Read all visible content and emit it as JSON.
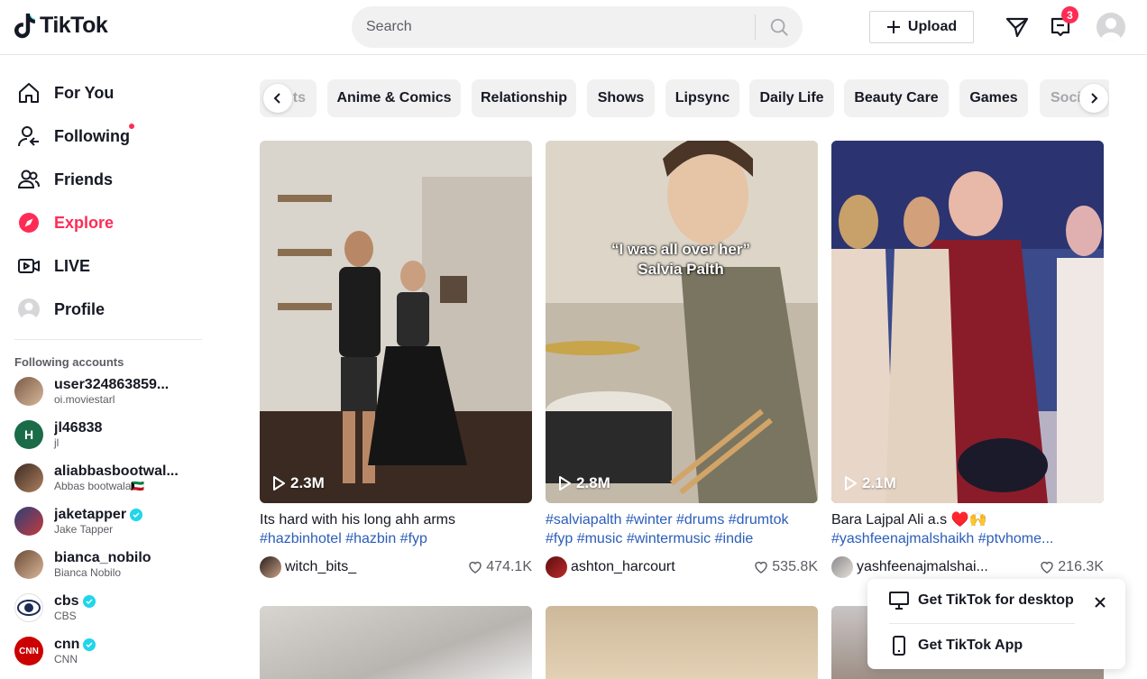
{
  "header": {
    "logo_text": "TikTok",
    "search_placeholder": "Search",
    "upload_label": "Upload",
    "inbox_badge": "3"
  },
  "nav": [
    {
      "label": "For You",
      "icon": "home-icon",
      "active": false
    },
    {
      "label": "Following",
      "icon": "following-icon",
      "active": false
    },
    {
      "label": "Friends",
      "icon": "friends-icon",
      "active": false
    },
    {
      "label": "Explore",
      "icon": "compass-icon",
      "active": true
    },
    {
      "label": "LIVE",
      "icon": "live-icon",
      "active": false
    },
    {
      "label": "Profile",
      "icon": "profile-icon",
      "active": false
    }
  ],
  "following": {
    "title": "Following accounts",
    "accounts": [
      {
        "name": "user324863859...",
        "sub": "oi.moviestarl",
        "verified": false
      },
      {
        "name": "jl46838",
        "sub": "jl",
        "verified": false,
        "initial": "H"
      },
      {
        "name": "aliabbasbootwal...",
        "sub": "Abbas bootwala🇰🇼",
        "verified": false
      },
      {
        "name": "jaketapper",
        "sub": "Jake Tapper",
        "verified": true
      },
      {
        "name": "bianca_nobilo",
        "sub": "Bianca Nobilo",
        "verified": false
      },
      {
        "name": "cbs",
        "sub": "CBS",
        "verified": true
      },
      {
        "name": "cnn",
        "sub": "CNN",
        "verified": true
      }
    ]
  },
  "categories": [
    "ts",
    "Anime & Comics",
    "Relationship",
    "Shows",
    "Lipsync",
    "Daily Life",
    "Beauty Care",
    "Games",
    "Soci"
  ],
  "videos": [
    {
      "views": "2.3M",
      "caption": "Its hard with his long ahh arms",
      "tags": "#hazbinhotel #hazbin #fyp",
      "user": "witch_bits_",
      "likes": "474.1K"
    },
    {
      "views": "2.8M",
      "caption": "",
      "tags": "#salviapalth #winter #drums #drumtok #fyp #music #wintermusic #indie",
      "overlay": "“I was all over her” Salvia Palth",
      "user": "ashton_harcourt",
      "likes": "535.8K"
    },
    {
      "views": "2.1M",
      "caption": "Bara Lajpal Ali a.s ♥️🙌",
      "tags": "#yashfeenajmalshaikh #ptvhome...",
      "user": "yashfeenajmalshai...",
      "likes": "216.3K"
    }
  ],
  "popup": {
    "desktop_label": "Get TikTok for desktop",
    "app_label": "Get TikTok App"
  },
  "colors": {
    "accent": "#fe2c55",
    "tag": "#2b5db9",
    "verified": "#20d5ec"
  }
}
